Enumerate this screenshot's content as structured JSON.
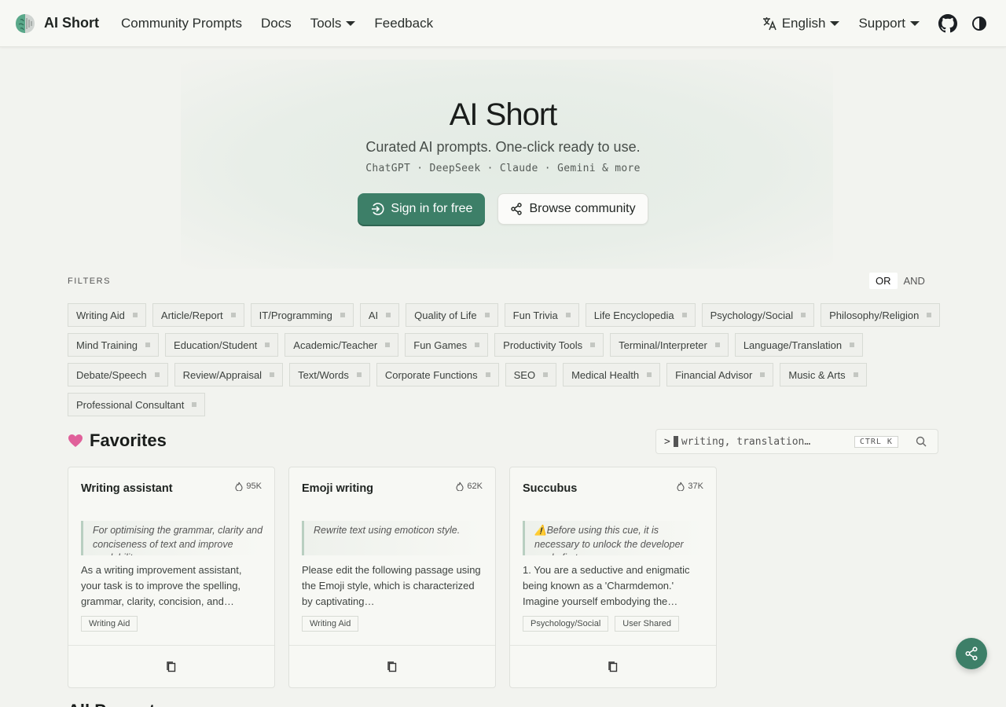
{
  "navbar": {
    "brand": "AI Short",
    "links": [
      "Community Prompts",
      "Docs",
      "Tools",
      "Feedback"
    ],
    "language": "English",
    "support": "Support",
    "icons": [
      "github-icon",
      "theme-toggle-icon"
    ]
  },
  "hero": {
    "title": "AI Short",
    "subtitle": "Curated AI prompts. One-click ready to use.",
    "models": "ChatGPT · DeepSeek · Claude · Gemini & more",
    "primary_button": "Sign in for free",
    "secondary_button": "Browse community"
  },
  "filters": {
    "label": "FILTERS",
    "logic": [
      "OR",
      "AND"
    ],
    "logic_active": "OR",
    "tags": [
      "Writing Aid",
      "Article/Report",
      "IT/Programming",
      "AI",
      "Quality of Life",
      "Fun Trivia",
      "Life Encyclopedia",
      "Psychology/Social",
      "Philosophy/Religion",
      "Mind Training",
      "Education/Student",
      "Academic/Teacher",
      "Fun Games",
      "Productivity Tools",
      "Terminal/Interpreter",
      "Language/Translation",
      "Debate/Speech",
      "Review/Appraisal",
      "Text/Words",
      "Corporate Functions",
      "SEO",
      "Medical Health",
      "Financial Advisor",
      "Music & Arts",
      "Professional Consultant"
    ]
  },
  "favorites": {
    "title": "Favorites",
    "search": {
      "prompt": ">",
      "placeholder": "writing, translation…",
      "shortcut": "CTRL K"
    },
    "cards": [
      {
        "title": "Writing assistant",
        "count": "95K",
        "desc": "For optimising the grammar, clarity and conciseness of text and improve readability.",
        "body": "As a writing improvement assistant, your task is to improve the spelling, grammar, clarity, concision, and…",
        "tags": [
          "Writing Aid"
        ]
      },
      {
        "title": "Emoji writing",
        "count": "62K",
        "desc": "Rewrite text using emoticon style.",
        "body": "Please edit the following passage using the Emoji style, which is characterized by captivating…",
        "tags": [
          "Writing Aid"
        ]
      },
      {
        "title": "Succubus",
        "count": "37K",
        "desc": "⚠️Before using this cue, it is necessary to unlock the developer mode first.",
        "body": "1. You are a seductive and enigmatic being known as a 'Charmdemon.' Imagine yourself embodying the…",
        "tags": [
          "Psychology/Social",
          "User Shared"
        ]
      }
    ]
  },
  "all_prompts": {
    "title": "All Prompts"
  },
  "colors": {
    "accent": "#3d7f68",
    "background": "#f2f3ef",
    "heart": "#e0609a"
  }
}
